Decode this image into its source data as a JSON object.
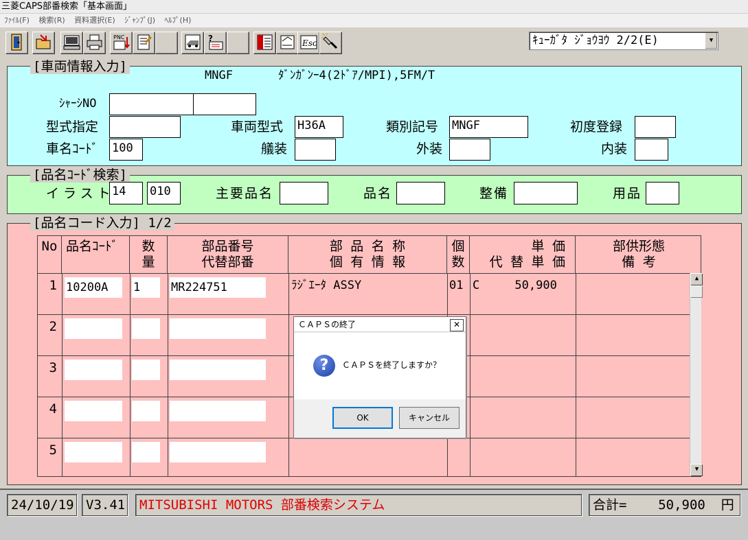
{
  "window": {
    "title": "三菱CAPS部番検索「基本画面」"
  },
  "menu": [
    "ﾌｧｲﾙ(F)",
    "検索(R)",
    "資料選択(E)",
    "ｼﾞｬﾝﾌﾟ(J)",
    "ﾍﾙﾌﾟ(H)"
  ],
  "toolbar": {
    "buttons": [
      "exit-door-icon",
      "open-folder-icon",
      "computer-icon",
      "printer-icon",
      "pnc-icon",
      "notebook-icon",
      "blank-icon",
      "model-icon",
      "question-doc-icon",
      "blank-icon",
      "list-icon",
      "edit-note-icon",
      "esc-icon",
      "flashlight-icon"
    ],
    "pnc_label": "PNC",
    "esc_label": "Esc",
    "mode_select": "ｷｭｰｶﾞﾀ ｼﾞｮｳﾖｳ 2/2(E)"
  },
  "vehicle": {
    "legend": "[車両情報入力]",
    "model_code": "MNGF",
    "model_desc": "ﾀﾞﾝｶﾞﾝｰ4(2ﾄﾞｱ/MPI),5FM/T",
    "chassis_label": "ｼｬｰｼNO",
    "chassis1": "",
    "chassis2": "",
    "type_spec_label": "型式指定",
    "type_spec": "",
    "vehicle_type_label": "車両型式",
    "vehicle_type": "H36A",
    "class_code_label": "類別記号",
    "class_code": "MNGF",
    "first_reg_label": "初度登録",
    "first_reg": "",
    "name_code_label": "車名ｺｰﾄﾞ",
    "name_code": "100",
    "trim_label": "艤装",
    "trim": "",
    "exterior_label": "外装",
    "exterior": "",
    "interior_label": "内装",
    "interior": ""
  },
  "search": {
    "legend": "[品名ｺｰﾄﾞ検索]",
    "illust_label": "イラスト",
    "illust1": "14",
    "illust2": "010",
    "main_name_label": "主要品名",
    "main_name": "",
    "name_label": "品名",
    "name": "",
    "service_label": "整備",
    "service": "",
    "goods_label": "用品",
    "goods": ""
  },
  "parts": {
    "legend": "[品名コード入力] 1/2",
    "headers": {
      "no": "No",
      "code": "品名ｺｰﾄﾞ",
      "qty1": "数",
      "qty2": "量",
      "partno1": "部品番号",
      "partno2": "代替部番",
      "name1": "部 品 名 称",
      "name2": "個 有 情 報",
      "count1": "個",
      "count2": "数",
      "price1": "単 価",
      "price2": "代 替 単 価",
      "note1": "部供形態",
      "note2": "備 考"
    },
    "rows": [
      {
        "no": "1",
        "code": "10200A",
        "qty": "1",
        "part_no": "MR224751",
        "name": "ﾗｼﾞｴｰﾀ ASSY",
        "count": "01",
        "price": "C     50,900"
      },
      {
        "no": "2",
        "code": "",
        "qty": "",
        "part_no": "",
        "name": "",
        "count": "",
        "price": ""
      },
      {
        "no": "3",
        "code": "",
        "qty": "",
        "part_no": "",
        "name": "",
        "count": "",
        "price": ""
      },
      {
        "no": "4",
        "code": "",
        "qty": "",
        "part_no": "",
        "name": "",
        "count": "",
        "price": ""
      },
      {
        "no": "5",
        "code": "",
        "qty": "",
        "part_no": "",
        "name": "",
        "count": "",
        "price": ""
      }
    ]
  },
  "dialog": {
    "title": "ＣＡＰＳの終了",
    "message": "ＣＡＰＳを終了しますか？",
    "ok": "OK",
    "cancel": "キャンセル",
    "close": "✕"
  },
  "status": {
    "date": "24/10/19",
    "version": "V3.41",
    "system": "MITSUBISHI MOTORS 部番検索システム",
    "total": "合計=    50,900  円"
  },
  "colors": {
    "vehicle_panel": "#c0ffff",
    "search_panel": "#c0ffc0",
    "parts_panel": "#ffc0c0",
    "system_text": "#e00000"
  }
}
